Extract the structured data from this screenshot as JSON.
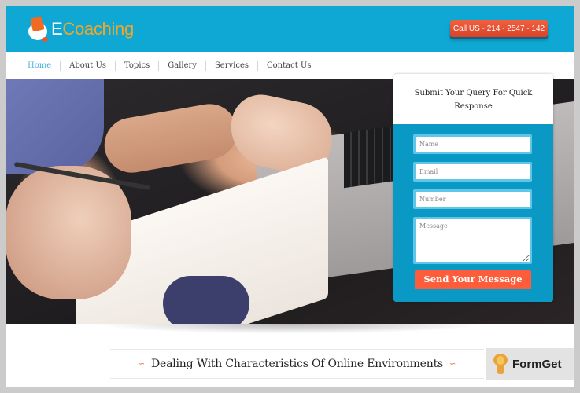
{
  "header": {
    "logo": {
      "first_letter": "E",
      "rest": "Coaching",
      "icon": "book-owl-logo-icon"
    },
    "call_button": "Call US - 214 - 2547 - 142",
    "colors": {
      "header_bg": "#0fa8d4",
      "logo_accent": "#f5a623",
      "call_button": "#e04e2f"
    }
  },
  "nav": {
    "items": [
      {
        "label": "Home",
        "active": true
      },
      {
        "label": "About Us",
        "active": false
      },
      {
        "label": "Topics",
        "active": false
      },
      {
        "label": "Gallery",
        "active": false
      },
      {
        "label": "Services",
        "active": false
      },
      {
        "label": "Contact Us",
        "active": false
      }
    ],
    "active_color": "#4bb3d8"
  },
  "hero": {
    "image_description": "hands writing on paper next to a laptop"
  },
  "query_form": {
    "title": "Submit Your Query For Quick Response",
    "fields": {
      "name": {
        "placeholder": "Name",
        "value": ""
      },
      "email": {
        "placeholder": "Email",
        "value": ""
      },
      "number": {
        "placeholder": "Number",
        "value": ""
      },
      "message": {
        "placeholder": "Message",
        "value": ""
      }
    },
    "submit_label": "Send Your Message",
    "colors": {
      "panel": "#0a99c5",
      "field_border": "#5fc6e7",
      "submit": "#fd5d3a"
    }
  },
  "section": {
    "heading": "Dealing With Characteristics Of Online Environments",
    "ornament_left": "∽",
    "ornament_right": "∽"
  },
  "watermark": {
    "label": "FormGet",
    "icon": "lion-mascot-icon"
  }
}
